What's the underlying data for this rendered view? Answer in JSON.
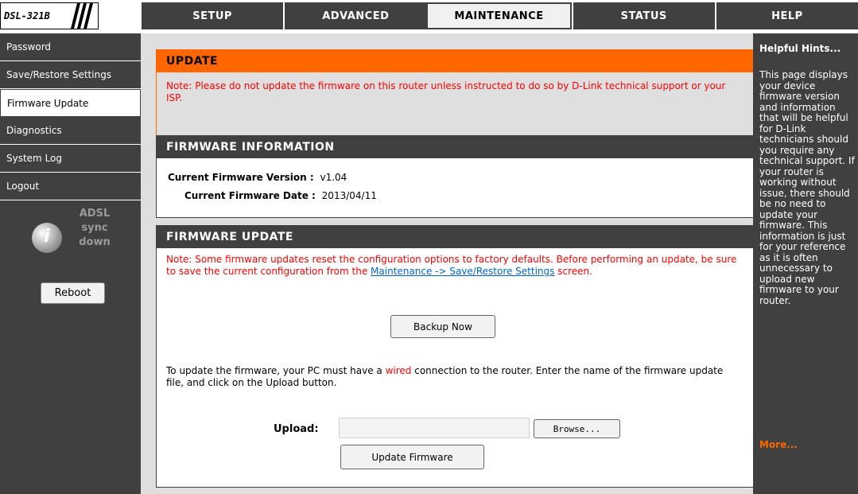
{
  "header": {
    "model": "DSL-321B",
    "tabs": [
      {
        "label": "SETUP",
        "active": false
      },
      {
        "label": "ADVANCED",
        "active": false
      },
      {
        "label": "MAINTENANCE",
        "active": true
      },
      {
        "label": "STATUS",
        "active": false
      },
      {
        "label": "HELP",
        "active": false
      }
    ]
  },
  "sidebar": {
    "items": [
      {
        "label": "Password",
        "active": false
      },
      {
        "label": "Save/Restore Settings",
        "active": false
      },
      {
        "label": "Firmware Update",
        "active": true
      },
      {
        "label": "Diagnostics",
        "active": false
      },
      {
        "label": "System Log",
        "active": false
      },
      {
        "label": "Logout",
        "active": false
      }
    ],
    "status_line1": "ADSL",
    "status_line2": "sync",
    "status_line3": "down",
    "reboot_label": "Reboot"
  },
  "update": {
    "title": "UPDATE",
    "note": "Note: Please do not update the firmware on this router unless instructed to do so by D-Link technical support or your ISP."
  },
  "firmware_info": {
    "title": "FIRMWARE INFORMATION",
    "version_label": "Current Firmware Version :",
    "version_value": "v1.04",
    "date_label": "Current Firmware Date :",
    "date_value": "2013/04/11"
  },
  "firmware_update": {
    "title": "FIRMWARE UPDATE",
    "note_pre": "Note: Some firmware updates reset the configuration options to factory defaults. Before performing an update, be sure to save the current configuration from the ",
    "note_link": "Maintenance -> Save/Restore Settings",
    "note_post": " screen.",
    "backup_label": "Backup Now",
    "instr_pre": "To update the firmware, your PC must have a ",
    "instr_red": "wired",
    "instr_post": " connection to the router. Enter the name of the firmware update file, and click on the Upload button.",
    "upload_label": "Upload:",
    "upload_value": "",
    "browse_label": "Browse...",
    "update_button_label": "Update Firmware"
  },
  "hints": {
    "title": "Helpful Hints...",
    "text": "This page displays your device firmware version and information that will be helpful for D-Link technicians should you require any technical support. If your router is working without issue, there should be no need to update your firmware. This information is just for your reference as it is often unnecessary to upload new firmware to your router.",
    "more": "More..."
  },
  "colors": {
    "accent": "#ff6600",
    "dark": "#404040",
    "panel": "#dfdfdf",
    "warning_text": "#ff0000"
  }
}
